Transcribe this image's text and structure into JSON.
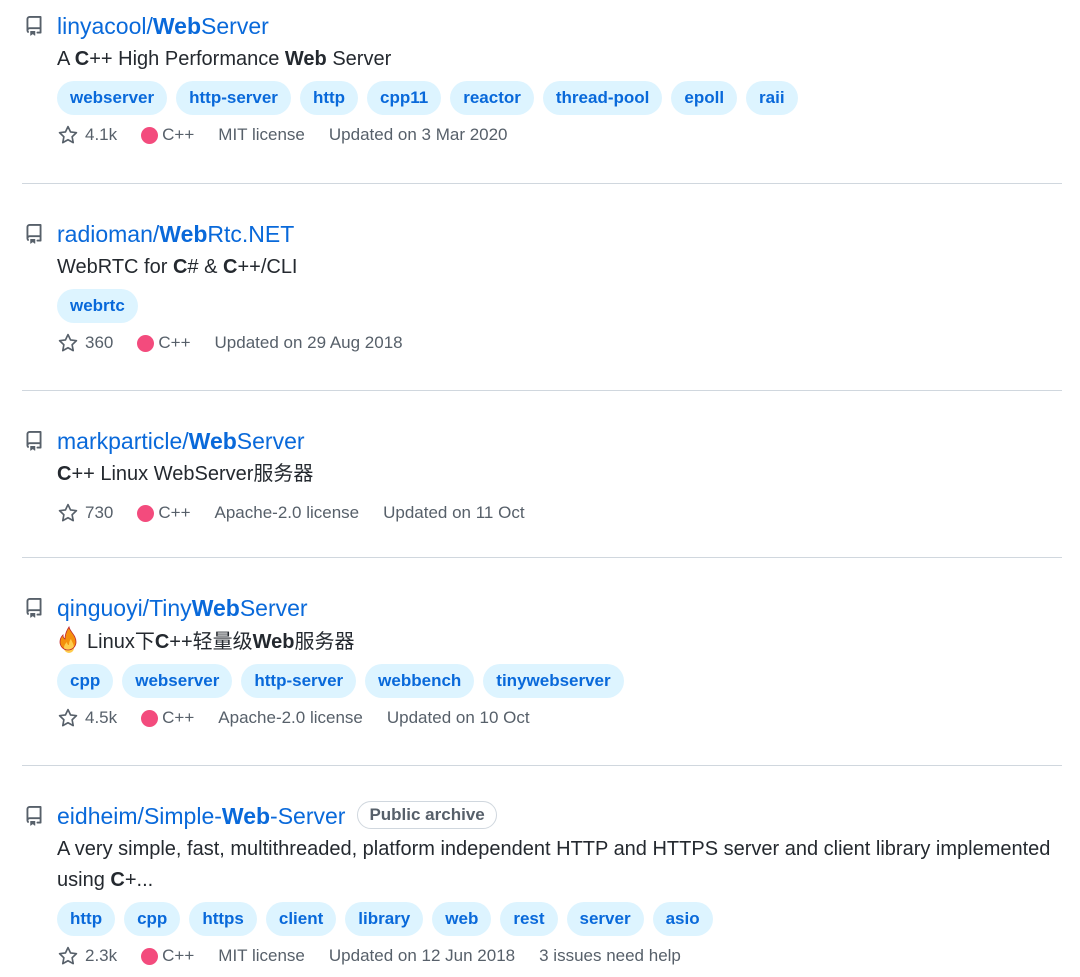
{
  "repos": [
    {
      "owner": "linyacool/",
      "name_parts": [
        "",
        "Web",
        "Server"
      ],
      "description_parts": [
        "A ",
        "C",
        "++ High Performance ",
        "Web",
        " Server"
      ],
      "topics": [
        "webserver",
        "http-server",
        "http",
        "cpp11",
        "reactor",
        "thread-pool",
        "epoll",
        "raii"
      ],
      "stars": "4.1k",
      "language": "C++",
      "license": "MIT license",
      "updated": "Updated on 3 Mar 2020"
    },
    {
      "owner": "radioman/",
      "name_parts": [
        "",
        "Web",
        "Rtc.NET"
      ],
      "description_parts": [
        "WebRTC for ",
        "C",
        "# & ",
        "C",
        "++/CLI"
      ],
      "topics": [
        "webrtc"
      ],
      "stars": "360",
      "language": "C++",
      "updated": "Updated on 29 Aug 2018"
    },
    {
      "owner": "markparticle/",
      "name_parts": [
        "",
        "Web",
        "Server"
      ],
      "description_parts": [
        "C",
        "++ Linux WebServer服务器"
      ],
      "topics": [],
      "stars": "730",
      "language": "C++",
      "license": "Apache-2.0 license",
      "updated": "Updated on 11 Oct"
    },
    {
      "owner": "qinguoyi/",
      "name_parts": [
        "Tiny",
        "Web",
        "Server"
      ],
      "description_parts": [
        "Linux下",
        "C",
        "++轻量级",
        "Web",
        "服务器"
      ],
      "description_icon": "fire-emoji-icon",
      "topics": [
        "cpp",
        "webserver",
        "http-server",
        "webbench",
        "tinywebserver"
      ],
      "stars": "4.5k",
      "language": "C++",
      "license": "Apache-2.0 license",
      "updated": "Updated on 10 Oct"
    },
    {
      "owner": "eidheim/",
      "name_parts": [
        "Simple-",
        "Web",
        "-Server"
      ],
      "badge": "Public archive",
      "description_parts": [
        "A very simple, fast, multithreaded, platform independent HTTP and HTTPS server and client library implemented using ",
        "C",
        "+..."
      ],
      "topics": [
        "http",
        "cpp",
        "https",
        "client",
        "library",
        "web",
        "rest",
        "server",
        "asio"
      ],
      "stars": "2.3k",
      "language": "C++",
      "license": "MIT license",
      "updated": "Updated on 12 Jun 2018",
      "help": "3 issues need help"
    }
  ],
  "colors": {
    "link": "#0969da",
    "topic_bg": "#ddf4ff",
    "cpp": "#f34b7d",
    "muted": "#57606a",
    "border": "#d0d7de"
  }
}
